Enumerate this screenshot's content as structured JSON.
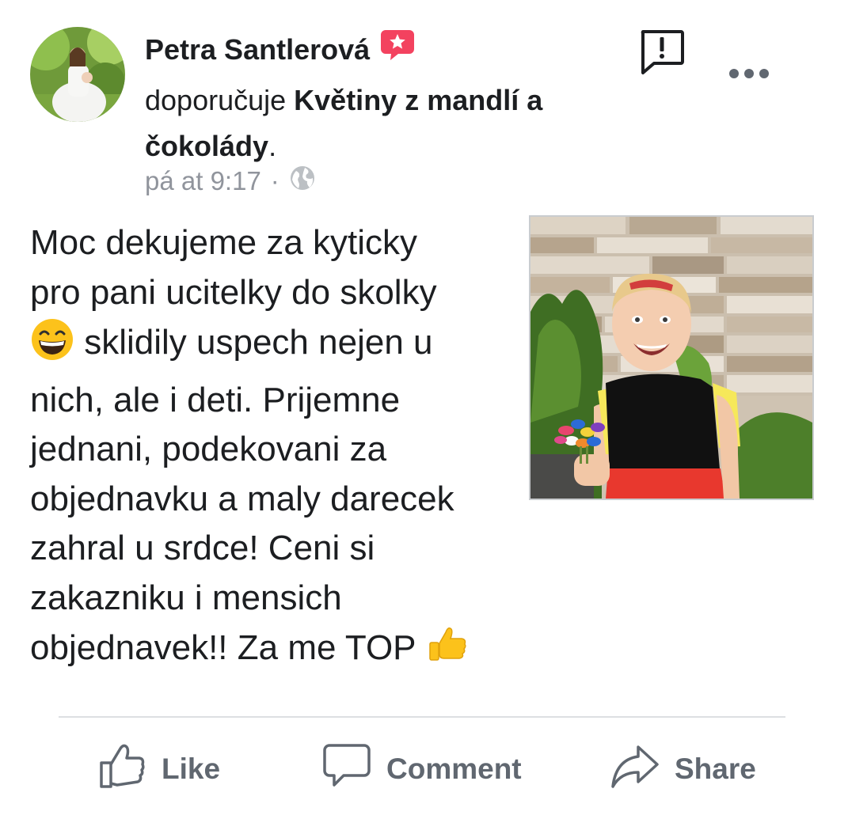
{
  "post": {
    "author": "Petra Santlerová",
    "recommend_verb": "doporučuje",
    "page_name": "Květiny z mandlí a čokolády",
    "page_suffix": ".",
    "timestamp": "pá at 9:17",
    "separator": "·",
    "privacy_icon": "globe-icon",
    "text_lines": [
      "Moc dekujeme za kyticky",
      "pro pani ucitelky do skolky",
      " sklidily uspech nejen u",
      "nich, ale i deti. Prijemne",
      "jednani, podekovani za",
      "objednavku a maly darecek",
      "zahral u srdce! Ceni si",
      "zakazniku i mensich",
      "objednavek!! Za me TOP "
    ]
  },
  "actions": {
    "like_label": "Like",
    "comment_label": "Comment",
    "share_label": "Share"
  },
  "colors": {
    "text": "#1c1e21",
    "meta": "#90949c",
    "action": "#606770",
    "badge": "#f3425f"
  }
}
